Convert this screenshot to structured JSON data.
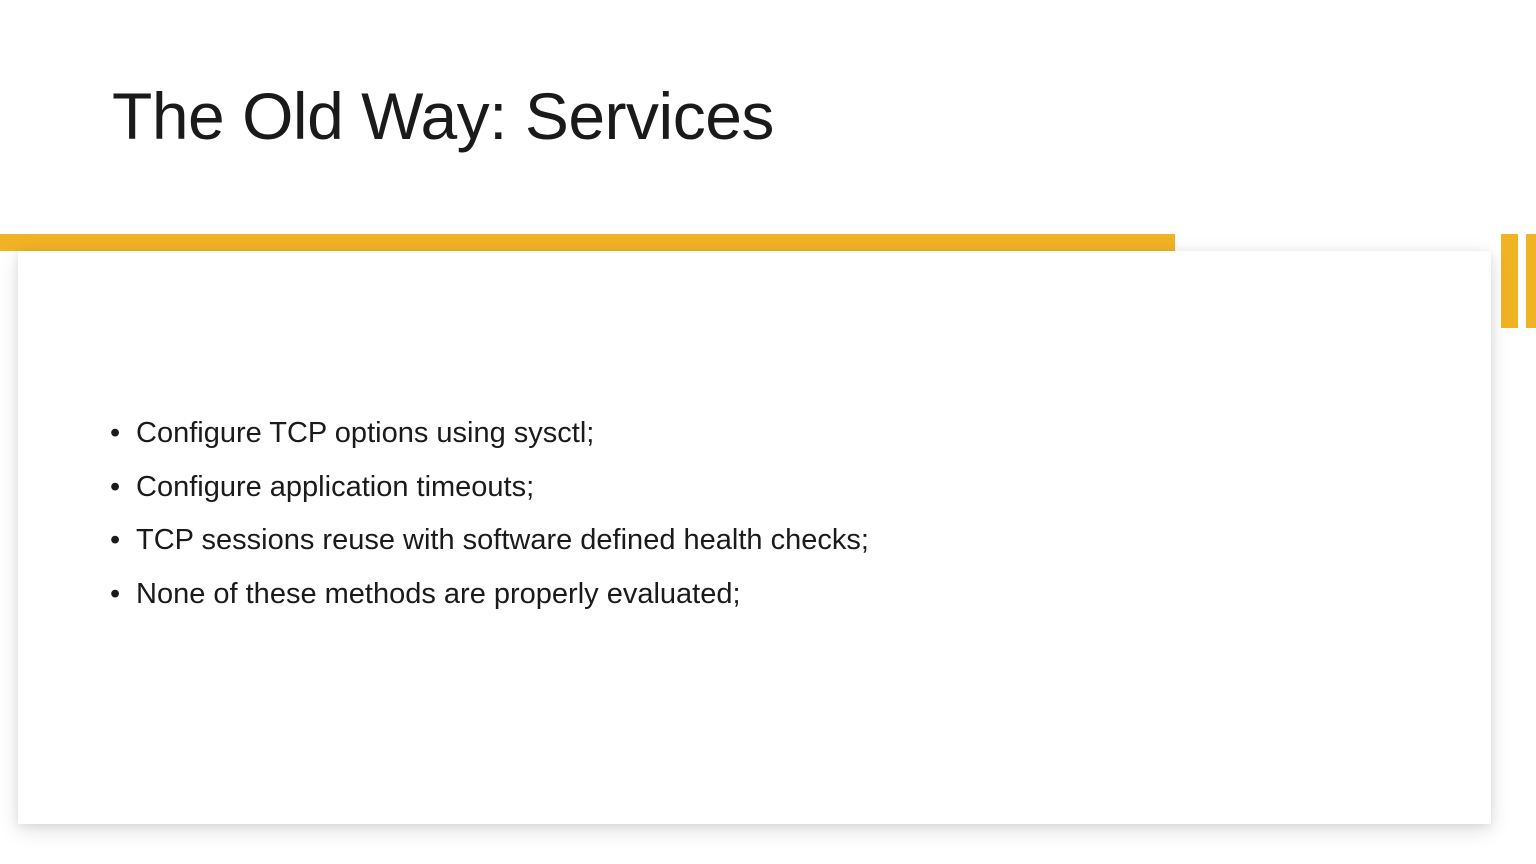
{
  "slide": {
    "title": "The Old Way: Services",
    "accent_color": "#f0b323",
    "bullets": [
      "Configure TCP options using sysctl;",
      "Configure application timeouts;",
      "TCP sessions reuse with software defined health checks;",
      "None of these methods are properly evaluated;"
    ]
  }
}
